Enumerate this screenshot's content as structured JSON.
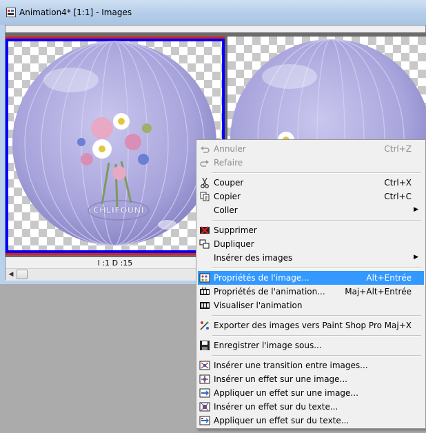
{
  "window": {
    "title": "Animation4* [1:1] - Images",
    "frame_label": "I :1   D :15",
    "watermark_text": "CHLIFOUNI"
  },
  "menu": {
    "items": [
      {
        "label": "Annuler",
        "shortcut": "Ctrl+Z",
        "icon": "undo-icon",
        "disabled": true
      },
      {
        "label": "Refaire",
        "shortcut": "",
        "icon": "redo-icon",
        "disabled": true
      },
      {
        "sep": true
      },
      {
        "label": "Couper",
        "shortcut": "Ctrl+X",
        "icon": "scissors-icon"
      },
      {
        "label": "Copier",
        "shortcut": "Ctrl+C",
        "icon": "copy-icon"
      },
      {
        "label": "Coller",
        "shortcut": "",
        "icon": "",
        "submenu": true
      },
      {
        "sep": true
      },
      {
        "label": "Supprimer",
        "shortcut": "",
        "icon": "delete-icon"
      },
      {
        "label": "Dupliquer",
        "shortcut": "",
        "icon": "duplicate-icon"
      },
      {
        "label": "Insérer des images",
        "shortcut": "",
        "icon": "",
        "submenu": true
      },
      {
        "sep": true
      },
      {
        "label": "Propriétés de l'image...",
        "shortcut": "Alt+Entrée",
        "icon": "frame-properties-icon",
        "highlight": true
      },
      {
        "label": "Propriétés de l'animation...",
        "shortcut": "Maj+Alt+Entrée",
        "icon": "animation-properties-icon"
      },
      {
        "label": "Visualiser l'animation",
        "shortcut": "",
        "icon": "film-icon"
      },
      {
        "sep": true
      },
      {
        "label": "Exporter des images vers Paint Shop Pro",
        "shortcut": "Maj+X",
        "icon": "export-icon"
      },
      {
        "sep": true
      },
      {
        "label": "Enregistrer l'image sous...",
        "shortcut": "",
        "icon": "save-frame-icon"
      },
      {
        "sep": true
      },
      {
        "label": "Insérer une transition entre images...",
        "shortcut": "",
        "icon": "transition-icon"
      },
      {
        "label": "Insérer un effet sur une image...",
        "shortcut": "",
        "icon": "insert-effect-icon"
      },
      {
        "label": "Appliquer un effet sur une image...",
        "shortcut": "",
        "icon": "apply-effect-icon"
      },
      {
        "label": "Insérer un effet sur du texte...",
        "shortcut": "",
        "icon": "insert-text-effect-icon"
      },
      {
        "label": "Appliquer un effet sur du texte...",
        "shortcut": "",
        "icon": "apply-text-effect-icon"
      }
    ]
  }
}
